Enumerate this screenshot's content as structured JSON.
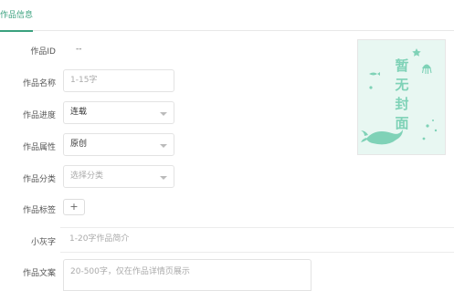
{
  "tabs": {
    "active_label": "作品信息"
  },
  "form": {
    "id": {
      "label": "作品ID",
      "value": "--"
    },
    "name": {
      "label": "作品名称",
      "placeholder": "1-15字"
    },
    "progress": {
      "label": "作品进度",
      "value": "连载"
    },
    "attribute": {
      "label": "作品属性",
      "value": "原创"
    },
    "category": {
      "label": "作品分类",
      "placeholder": "选择分类"
    },
    "tags": {
      "label": "作品标签",
      "add_label": "+"
    },
    "blurb": {
      "label": "小灰字",
      "placeholder": "1-20字作品简介"
    },
    "description": {
      "label": "作品文案",
      "placeholder": "20-500字，仅在作品详情页展示"
    }
  },
  "cover": {
    "text": "暂无封面",
    "colors": {
      "background": "#e8f7f2",
      "ink": "#7fd2b7"
    }
  },
  "colors": {
    "accent": "#3aa17e"
  }
}
